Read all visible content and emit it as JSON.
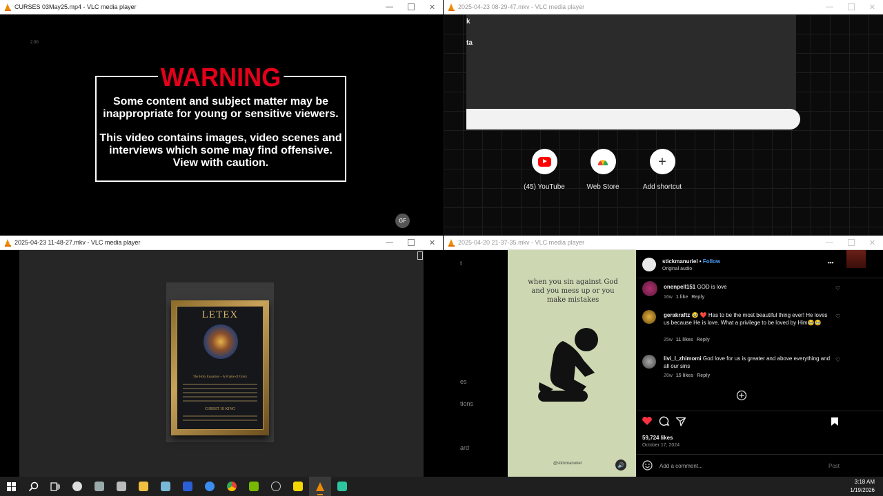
{
  "windows": [
    {
      "title": "CURSES 03May25.mp4 - VLC media player"
    },
    {
      "title": "2025-04-23 08-29-47.mkv - VLC media player"
    },
    {
      "title": "2025-04-23 11-48-27.mkv - VLC media player"
    },
    {
      "title": "2025-04-20 21-37-35.mkv - VLC media player"
    }
  ],
  "window_controls": {
    "minimize": "—",
    "close": "✕"
  },
  "video1": {
    "corner_tag": "2.00",
    "warning_title": "WARNING",
    "line1": "Some content and subject matter may be",
    "line2": "inappropriate for young or sensitive viewers.",
    "line3": "This video contains images, video scenes and",
    "line4": "interviews which some may find offensive.",
    "line5": "View with caution.",
    "logo": "GF"
  },
  "video2": {
    "frag1": "k",
    "frag2": "ta",
    "shortcuts": [
      {
        "label": "(45) YouTube",
        "icon": "youtube-icon"
      },
      {
        "label": "Web Store",
        "icon": "chrome-web-store-icon"
      },
      {
        "label": "Add shortcut",
        "icon": "plus-icon"
      }
    ],
    "plus": "+"
  },
  "video3": {
    "poster_title": "LETEX",
    "poster_subtitle": "The Holy Equation – A Frame of Glory",
    "poster_footer": "CHRIST IS KING"
  },
  "video4": {
    "left_frags": [
      "t",
      "es",
      "tions",
      "ard"
    ],
    "reel_text": "when you sin against God and you mess up or you make mistakes",
    "reel_handle": "@stickmanuriel",
    "author": "stickmanuriel",
    "follow": "Follow",
    "audio": "Original audio",
    "more": "•••",
    "comments": [
      {
        "user": "onenpell151",
        "text": "GOD is love",
        "age": "16w",
        "likes": "1 like",
        "reply": "Reply"
      },
      {
        "user": "gerakraftz",
        "text": "🥹 ❤️ Has to be the most beautiful thing ever! He loves us because He is love. What a privilege to be loved by Him🥹🥹",
        "age": "25w",
        "likes": "11 likes",
        "reply": "Reply"
      },
      {
        "user": "livi_l_zhimomi",
        "text": "God love for us is greater and above everything and all our sins",
        "age": "26w",
        "likes": "15 likes",
        "reply": "Reply"
      }
    ],
    "likes": "59,724 likes",
    "date": "October 17, 2024",
    "comment_placeholder": "Add a comment...",
    "post": "Post"
  },
  "taskbar": {
    "time": "3:18 AM",
    "date": "1/19/2026"
  },
  "colors": {
    "warning_red": "#e4001b",
    "vlc_orange": "#f08a00",
    "ig_blue": "#4a9ef5",
    "ig_heart": "#ff3040"
  }
}
